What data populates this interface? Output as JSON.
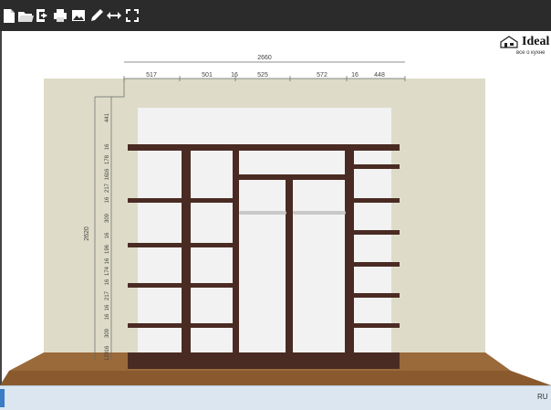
{
  "toolbar": {
    "buttons": [
      {
        "name": "new-file-button",
        "icon": "file-icon"
      },
      {
        "name": "open-button",
        "icon": "folder-open-icon"
      },
      {
        "name": "export-button",
        "icon": "export-icon"
      },
      {
        "name": "print-button",
        "icon": "print-icon"
      },
      {
        "name": "image-button",
        "icon": "image-icon"
      },
      {
        "name": "edit-button",
        "icon": "pencil-icon"
      },
      {
        "name": "resize-button",
        "icon": "arrows-horizontal-icon"
      },
      {
        "name": "fullscreen-button",
        "icon": "fullscreen-icon"
      }
    ]
  },
  "logo": {
    "name": "Ideal",
    "tagline": "все о кухне"
  },
  "drawing": {
    "total_width": "2660",
    "total_height": "2620",
    "top_dims": [
      "517",
      "501",
      "16",
      "525",
      "572",
      "16",
      "448"
    ],
    "left_dims": [
      "441",
      "16",
      "178",
      "16",
      "16",
      "217",
      "16",
      "309",
      "16",
      "196",
      "16",
      "174",
      "16",
      "217",
      "16",
      "16",
      "309",
      "16",
      "129"
    ],
    "colors": {
      "wall": "#dedcc8",
      "recess": "#f2f2f2",
      "wood": "#4a2b23",
      "floor": "#8a5a2e",
      "dim_line": "#666666"
    }
  },
  "taskbar": {
    "language": "RU"
  }
}
